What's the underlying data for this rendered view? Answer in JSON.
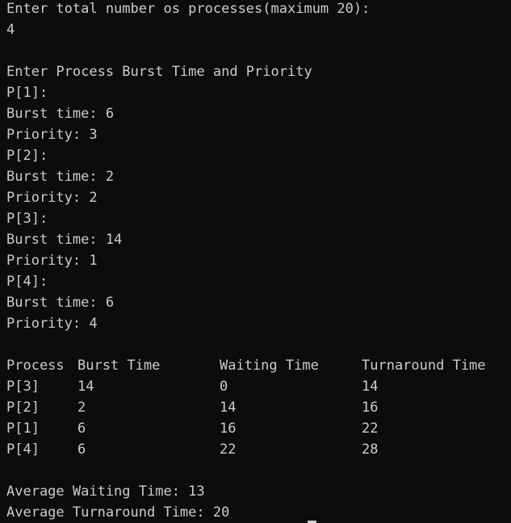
{
  "terminal": {
    "prompt_count": "Enter total number os processes(maximum 20):",
    "count_value": "4",
    "prompt_burst": "Enter Process Burst Time and Priority",
    "inputs": [
      {
        "label": "P[1]:",
        "burst": "Burst time: 6",
        "priority": "Priority: 3"
      },
      {
        "label": "P[2]:",
        "burst": "Burst time: 2",
        "priority": "Priority: 2"
      },
      {
        "label": "P[3]:",
        "burst": "Burst time: 14",
        "priority": "Priority: 1"
      },
      {
        "label": "P[4]:",
        "burst": "Burst time: 6",
        "priority": "Priority: 4"
      }
    ],
    "table_headers": [
      "Process",
      "Burst Time",
      "Waiting Time",
      "Turnaround Time"
    ],
    "table_rows": [
      [
        "P[3]",
        "14",
        "0",
        "14"
      ],
      [
        "P[2]",
        "2",
        "14",
        "16"
      ],
      [
        "P[1]",
        "6",
        "16",
        "22"
      ],
      [
        "P[4]",
        "6",
        "22",
        "28"
      ]
    ],
    "avg_waiting": "Average Waiting Time: 13",
    "avg_turnaround": "Average Turnaround Time: 20"
  },
  "colors": {
    "background": "#0c0c0c",
    "foreground": "#cccccc"
  }
}
